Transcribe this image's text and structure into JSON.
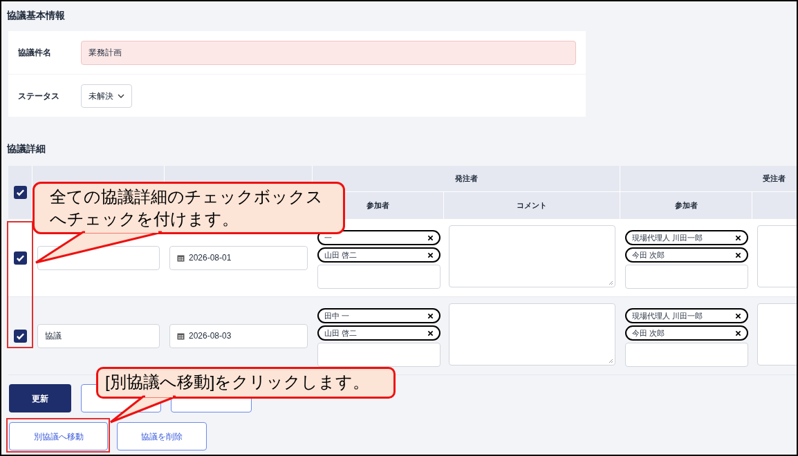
{
  "basic_info": {
    "title": "協議基本情報",
    "fields": [
      {
        "kind": "text",
        "label": "協議件名",
        "value": "業務計画",
        "invalid": true
      },
      {
        "kind": "select",
        "label": "ステータス",
        "value": "未解決",
        "invalid": false
      }
    ]
  },
  "details": {
    "title": "協議詳細",
    "select_all": {
      "checked": true
    },
    "column_groups": [
      {
        "label": "発注者",
        "columns": [
          "参加者",
          "コメント"
        ]
      },
      {
        "label": "受注者",
        "columns": [
          "参加者"
        ]
      }
    ],
    "rows": [
      {
        "checked": true,
        "date": "2026-08-01",
        "client_participants": [
          "一",
          "山田 啓二"
        ],
        "contractor_participants": [
          "現場代理人 川田一郎",
          "今田 次郎"
        ]
      },
      {
        "checked": true,
        "title": "協議",
        "date": "2026-08-03",
        "client_participants": [
          "田中 一",
          "山田 啓二"
        ],
        "contractor_participants": [
          "現場代理人 川田一郎",
          "今田 次郎"
        ]
      }
    ]
  },
  "buttons_row_1": [
    {
      "kind": "primary",
      "label": "更新"
    },
    {
      "kind": "outline"
    },
    {
      "kind": "outline"
    }
  ],
  "buttons_row_2": [
    {
      "kind": "outline",
      "label": "別協議へ移動"
    },
    {
      "kind": "outline",
      "label": "協議を削除"
    }
  ],
  "callouts": [
    {
      "text": "全ての協議詳細のチェックボックスへチェックを付けます。"
    },
    {
      "text": "[別協議へ移動]をクリックします。"
    }
  ]
}
